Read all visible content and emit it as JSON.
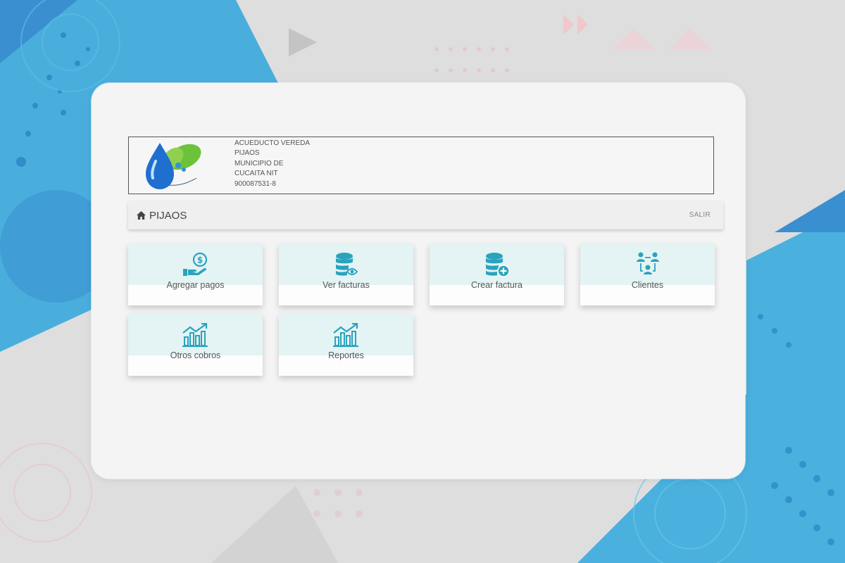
{
  "header": {
    "org_lines": [
      "ACUEDUCTO VEREDA",
      "PIJAOS",
      "MUNICIPIO DE",
      "CUCAITA NIT",
      "900087531-8"
    ]
  },
  "navbar": {
    "brand": "PIJAOS",
    "brand_icon": "home-icon",
    "logout": "SALIR"
  },
  "tiles": [
    {
      "label": "Agregar pagos",
      "icon": "payment-hand-icon"
    },
    {
      "label": "Ver facturas",
      "icon": "database-view-icon"
    },
    {
      "label": "Crear factura",
      "icon": "database-add-icon"
    },
    {
      "label": "Clientes",
      "icon": "clients-network-icon"
    },
    {
      "label": "Otros cobros",
      "icon": "bar-chart-icon"
    },
    {
      "label": "Reportes",
      "icon": "bar-chart-icon"
    }
  ],
  "colors": {
    "icon": "#2aa3bd",
    "tile_top": "#e4f3f3",
    "bg_blue": "#3fa9d8"
  }
}
